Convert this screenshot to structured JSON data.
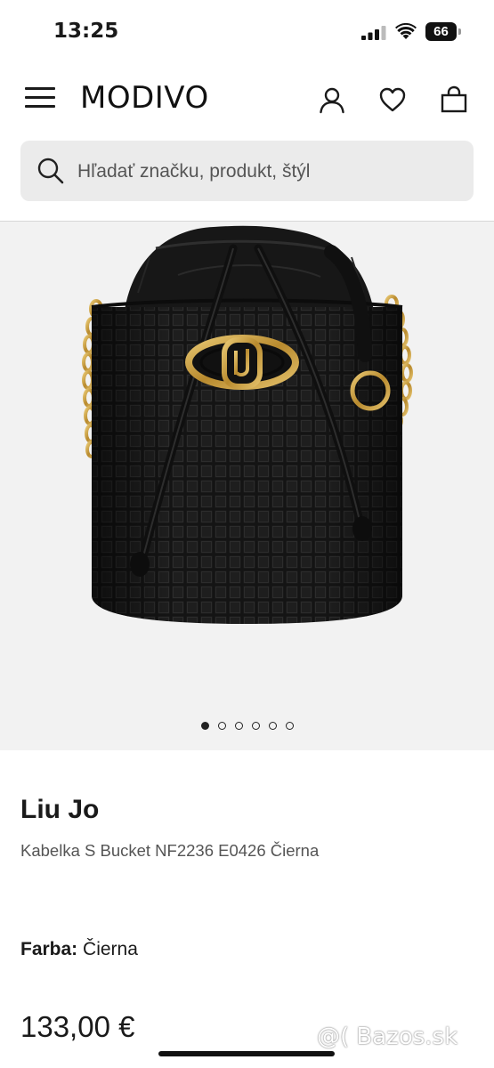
{
  "status_bar": {
    "time": "13:25",
    "battery": "66"
  },
  "header": {
    "logo": "MODIVO"
  },
  "search": {
    "placeholder": "Hľadať značku, produkt, štýl"
  },
  "gallery": {
    "dot_count": 6,
    "active_index": 0
  },
  "product": {
    "brand": "Liu Jo",
    "name": "Kabelka S Bucket NF2236 E0426 Čierna",
    "color_label": "Farba:",
    "color_value": "Čierna",
    "price": "133,00 €"
  },
  "watermark": "@( Bazos.sk"
}
